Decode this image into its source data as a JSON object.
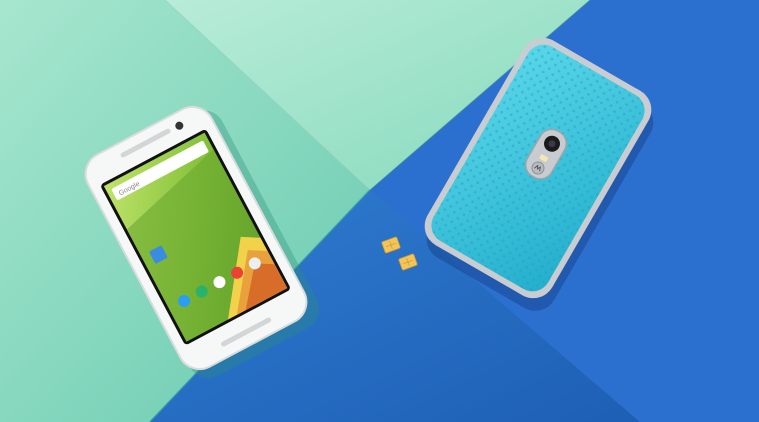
{
  "scene": {
    "colors": {
      "mint_light": "#9fe0c6",
      "mint_mid": "#6fd1b3",
      "teal_shadow": "#3aa38f",
      "blue_light": "#3f86d8",
      "blue_deep": "#1f5fb8",
      "blue_mid": "#2d73cc",
      "phone_white": "#f4f6f6",
      "screen_green": "#8cc63f",
      "back_cyan": "#35c3dc",
      "frame_silver": "#c9ccd0",
      "sim_gold": "#f2c45a"
    },
    "icons": [
      "front-phone",
      "back-phone",
      "sim-card"
    ]
  },
  "front_phone": {
    "search_bar_text": "Google"
  }
}
